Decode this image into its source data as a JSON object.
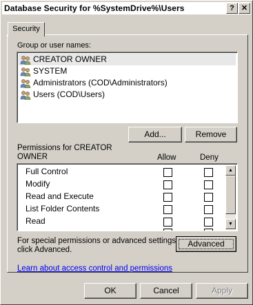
{
  "window": {
    "title": "Database Security for %SystemDrive%\\Users",
    "help_btn": "?",
    "close_btn": "✕"
  },
  "tabs": [
    {
      "label": "Security"
    }
  ],
  "groups": {
    "label": "Group or user names:",
    "items": [
      {
        "name": "CREATOR OWNER"
      },
      {
        "name": "SYSTEM"
      },
      {
        "name": "Administrators (COD\\Administrators)"
      },
      {
        "name": "Users (COD\\Users)"
      }
    ],
    "add_label": "Add...",
    "remove_label": "Remove"
  },
  "permissions": {
    "label_line1": "Permissions for CREATOR",
    "label_line2": "OWNER",
    "allow_header": "Allow",
    "deny_header": "Deny",
    "rows": [
      {
        "name": "Full Control",
        "allow": false,
        "deny": false
      },
      {
        "name": "Modify",
        "allow": false,
        "deny": false
      },
      {
        "name": "Read and Execute",
        "allow": false,
        "deny": false
      },
      {
        "name": "List Folder Contents",
        "allow": false,
        "deny": false
      },
      {
        "name": "Read",
        "allow": false,
        "deny": false
      }
    ]
  },
  "advanced": {
    "text_line1": "For special permissions or advanced settings,",
    "text_line2": "click Advanced.",
    "button": "Advanced"
  },
  "help_link": "Learn about access control and permissions",
  "footer": {
    "ok": "OK",
    "cancel": "Cancel",
    "apply": "Apply"
  }
}
